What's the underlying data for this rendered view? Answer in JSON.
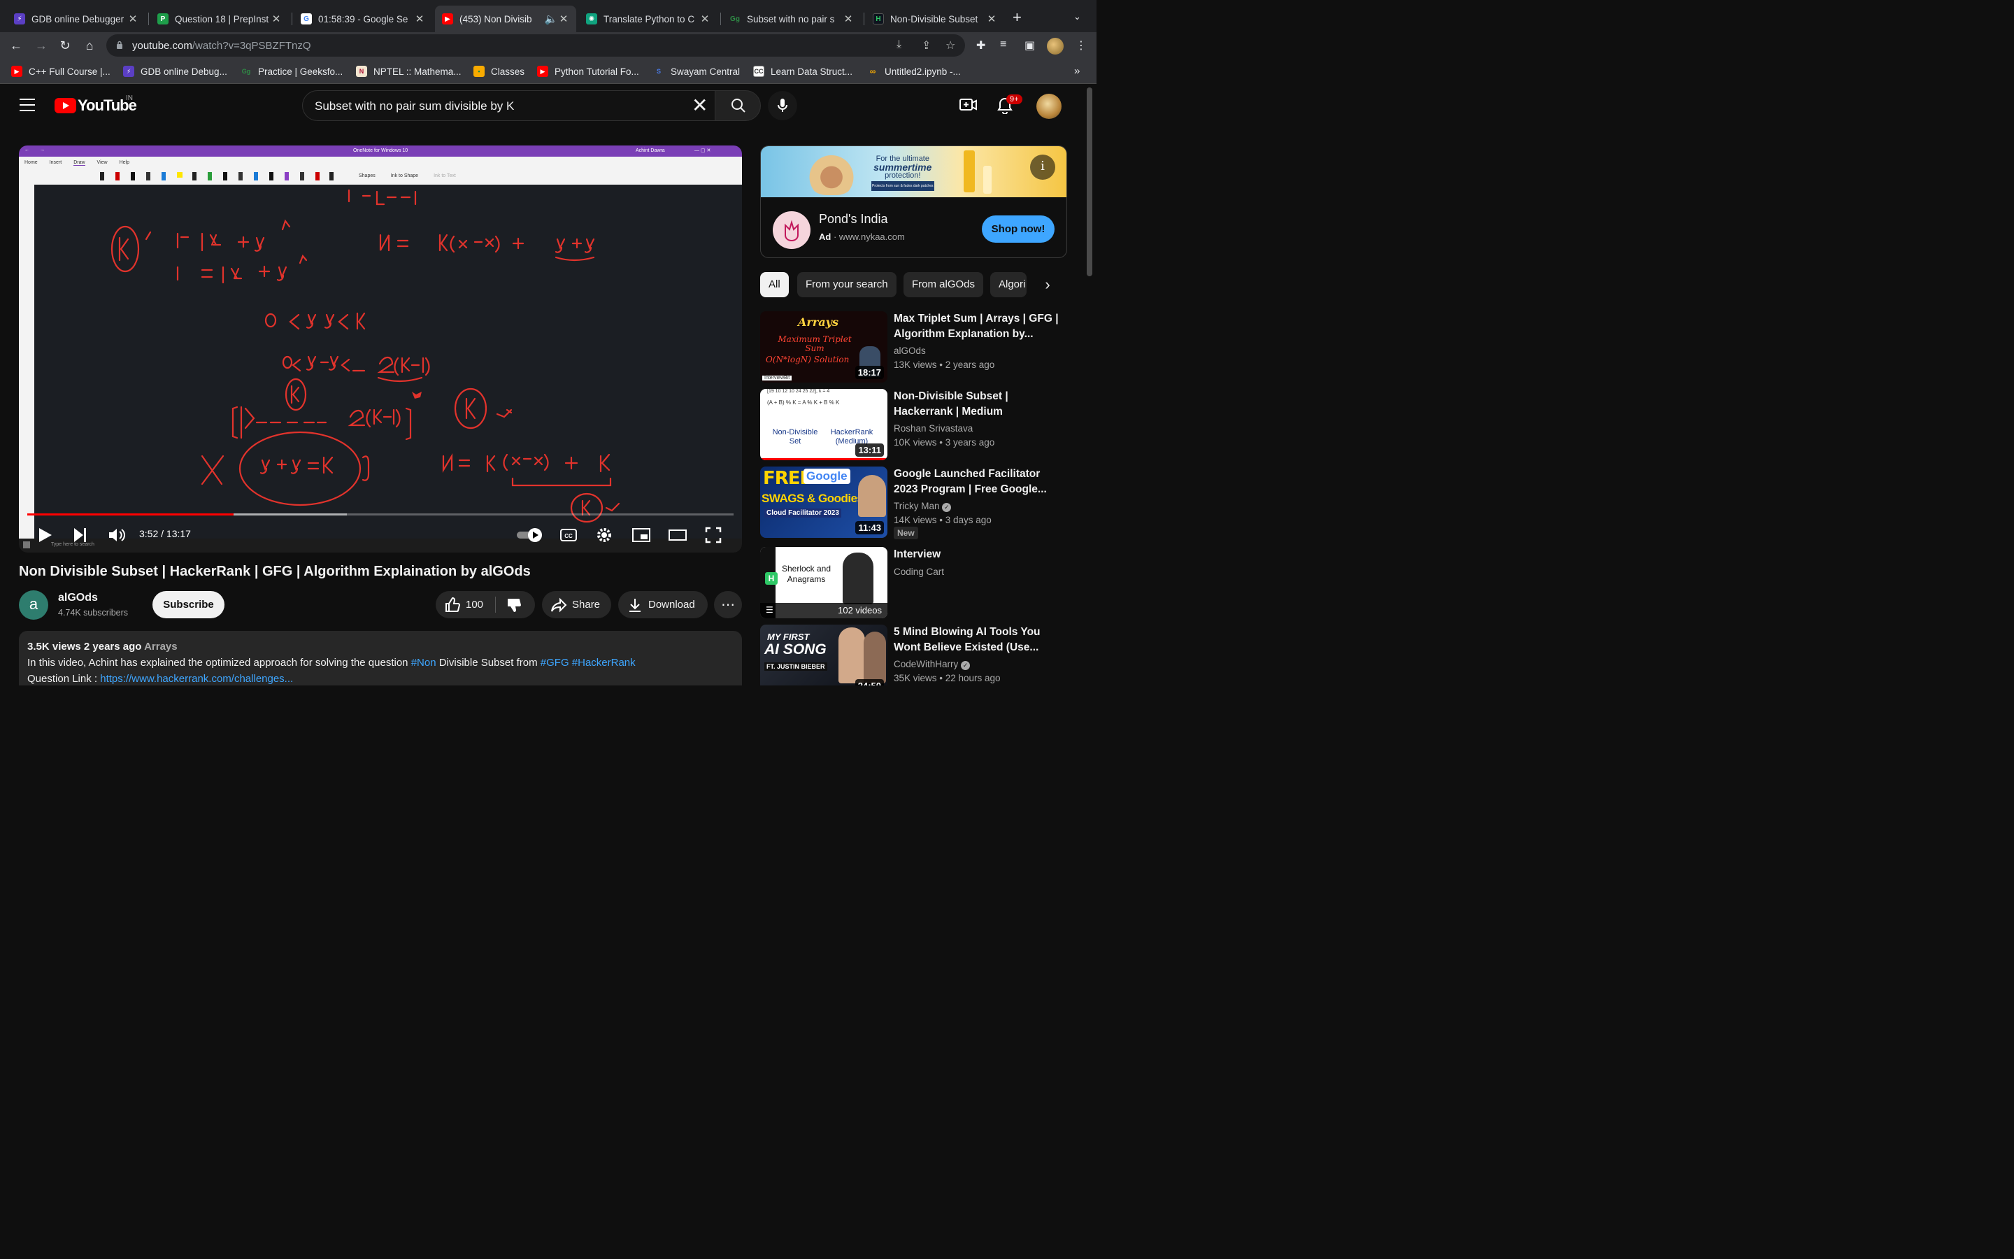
{
  "browser": {
    "tabs": [
      {
        "title": "GDB online Debugger",
        "icon": "gdb-icon",
        "color": "#5b3fc4"
      },
      {
        "title": "Question 18 | PrepInst",
        "icon": "prepinsta-icon",
        "color": "#1e9e4a"
      },
      {
        "title": "01:58:39 - Google Se",
        "icon": "google-icon",
        "color": "#ffffff"
      },
      {
        "title": "(453) Non Divisib",
        "icon": "youtube-icon",
        "color": "#ff0000",
        "active": true
      },
      {
        "title": "Translate Python to C",
        "icon": "chatgpt-icon",
        "color": "#10a37f"
      },
      {
        "title": "Subset with no pair s",
        "icon": "geeksforgeeks-icon",
        "color": "#2f8d46"
      },
      {
        "title": "Non-Divisible Subset",
        "icon": "hackerrank-icon",
        "color": "#0e141e"
      }
    ],
    "url_host": "youtube.com",
    "url_path": "/watch?v=3qPSBZFTnzQ",
    "bookmarks": [
      {
        "label": "C++ Full Course |...",
        "icon": "youtube-icon"
      },
      {
        "label": "GDB online Debug...",
        "icon": "gdb-icon"
      },
      {
        "label": "Practice | Geeksfo...",
        "icon": "geeksforgeeks-icon"
      },
      {
        "label": "NPTEL :: Mathema...",
        "icon": "nptel-icon"
      },
      {
        "label": "Classes",
        "icon": "classroom-icon"
      },
      {
        "label": "Python Tutorial Fo...",
        "icon": "youtube-icon"
      },
      {
        "label": "Swayam Central",
        "icon": "swayam-icon"
      },
      {
        "label": "Learn Data Struct...",
        "icon": "cc-icon"
      },
      {
        "label": "Untitled2.ipynb -...",
        "icon": "colab-icon"
      }
    ]
  },
  "youtube": {
    "logo_text": "YouTube",
    "country": "IN",
    "search_query": "Subset with no pair sum divisible by K",
    "notifications": "9+"
  },
  "video": {
    "time": "3:52 / 13:17",
    "progress": 0.292,
    "buffered": 0.452,
    "onenote_title": "OneNote for Windows 10",
    "onenote_user": "Achint Dawra",
    "ribbon_tabs": [
      "Home",
      "Insert",
      "Draw",
      "View",
      "Help"
    ],
    "ribbon_tools": [
      "Shapes",
      "Ink to Shape",
      "Ink to Text"
    ],
    "taskbar_search": "Type here to search",
    "title": "Non Divisible Subset | HackerRank | GFG | Algorithm Explaination by alGOds",
    "channel": "alGOds",
    "channel_initial": "a",
    "subscribers": "4.74K subscribers",
    "subscribe_label": "Subscribe",
    "likes": "100",
    "share_label": "Share",
    "download_label": "Download",
    "views_date": "3.5K views  2 years ago",
    "tag": "Arrays",
    "desc_pre": "In this video, Achint has explained the optimized approach for solving the question ",
    "desc_hash1": "#Non",
    "desc_mid": " Divisible Subset from ",
    "desc_hash2": "#GFG #HackerRank",
    "question_link_label": "Question Link : ",
    "question_link": "https://www.hackerrank.com/challenges..."
  },
  "ad": {
    "banner_line1": "For the ultimate",
    "banner_line2": "summertime",
    "banner_line3": "protection!",
    "banner_small": "Protects from sun & fades dark patches",
    "name": "Pond's India",
    "ad_label": "Ad",
    "domain": "www.nykaa.com",
    "cta": "Shop now!"
  },
  "chips": [
    "All",
    "From your search",
    "From alGOds",
    "Algori"
  ],
  "recommendations": [
    {
      "title": "Max Triplet Sum | Arrays | GFG | Algorithm Explanation by...",
      "channel": "alGOds",
      "meta": "13K views  • 2 years ago",
      "duration": "18:17",
      "thumb_line1": "Arrays",
      "thumb_line2": "Maximum Triplet Sum",
      "thumb_line3": "O(N*logN) Solution",
      "thumb_tag": "InterviewBit"
    },
    {
      "title": "Non-Divisible Subset | Hackerrank | Medium",
      "channel": "Roshan Srivastava",
      "meta": "10K views  • 3 years ago",
      "duration": "13:11",
      "thumb_line1": "[19 10 12 10 24 25 22], k = 4",
      "thumb_line2": "(A + B) % K = A % K + B % K",
      "thumb_line3": "Non-Divisible Set",
      "thumb_tag": "HackerRank (Medium)"
    },
    {
      "title": "Google Launched Facilitator 2023 Program | Free Google...",
      "channel": "Tricky Man",
      "meta": "14K views  • 3 days ago",
      "duration": "11:43",
      "badge": "New",
      "thumb_line1": "FREE",
      "thumb_line2": "SWAGS & Goodies",
      "thumb_line3": "Cloud Facilitator 2023",
      "thumb_tag": "Google"
    },
    {
      "title": "Interview",
      "channel": "Coding Cart",
      "meta": "",
      "duration": "102 videos",
      "thumb_line1": "Sherlock and Anagrams",
      "thumb_tag": "H"
    },
    {
      "title": "5 Mind Blowing AI Tools You Wont Believe Existed (Use...",
      "channel": "CodeWithHarry",
      "meta": "35K views  • 22 hours ago",
      "duration": "24:50",
      "thumb_line1": "MY FIRST",
      "thumb_line2": "AI SONG",
      "thumb_line3": "FT. JUSTIN BIEBER"
    }
  ]
}
